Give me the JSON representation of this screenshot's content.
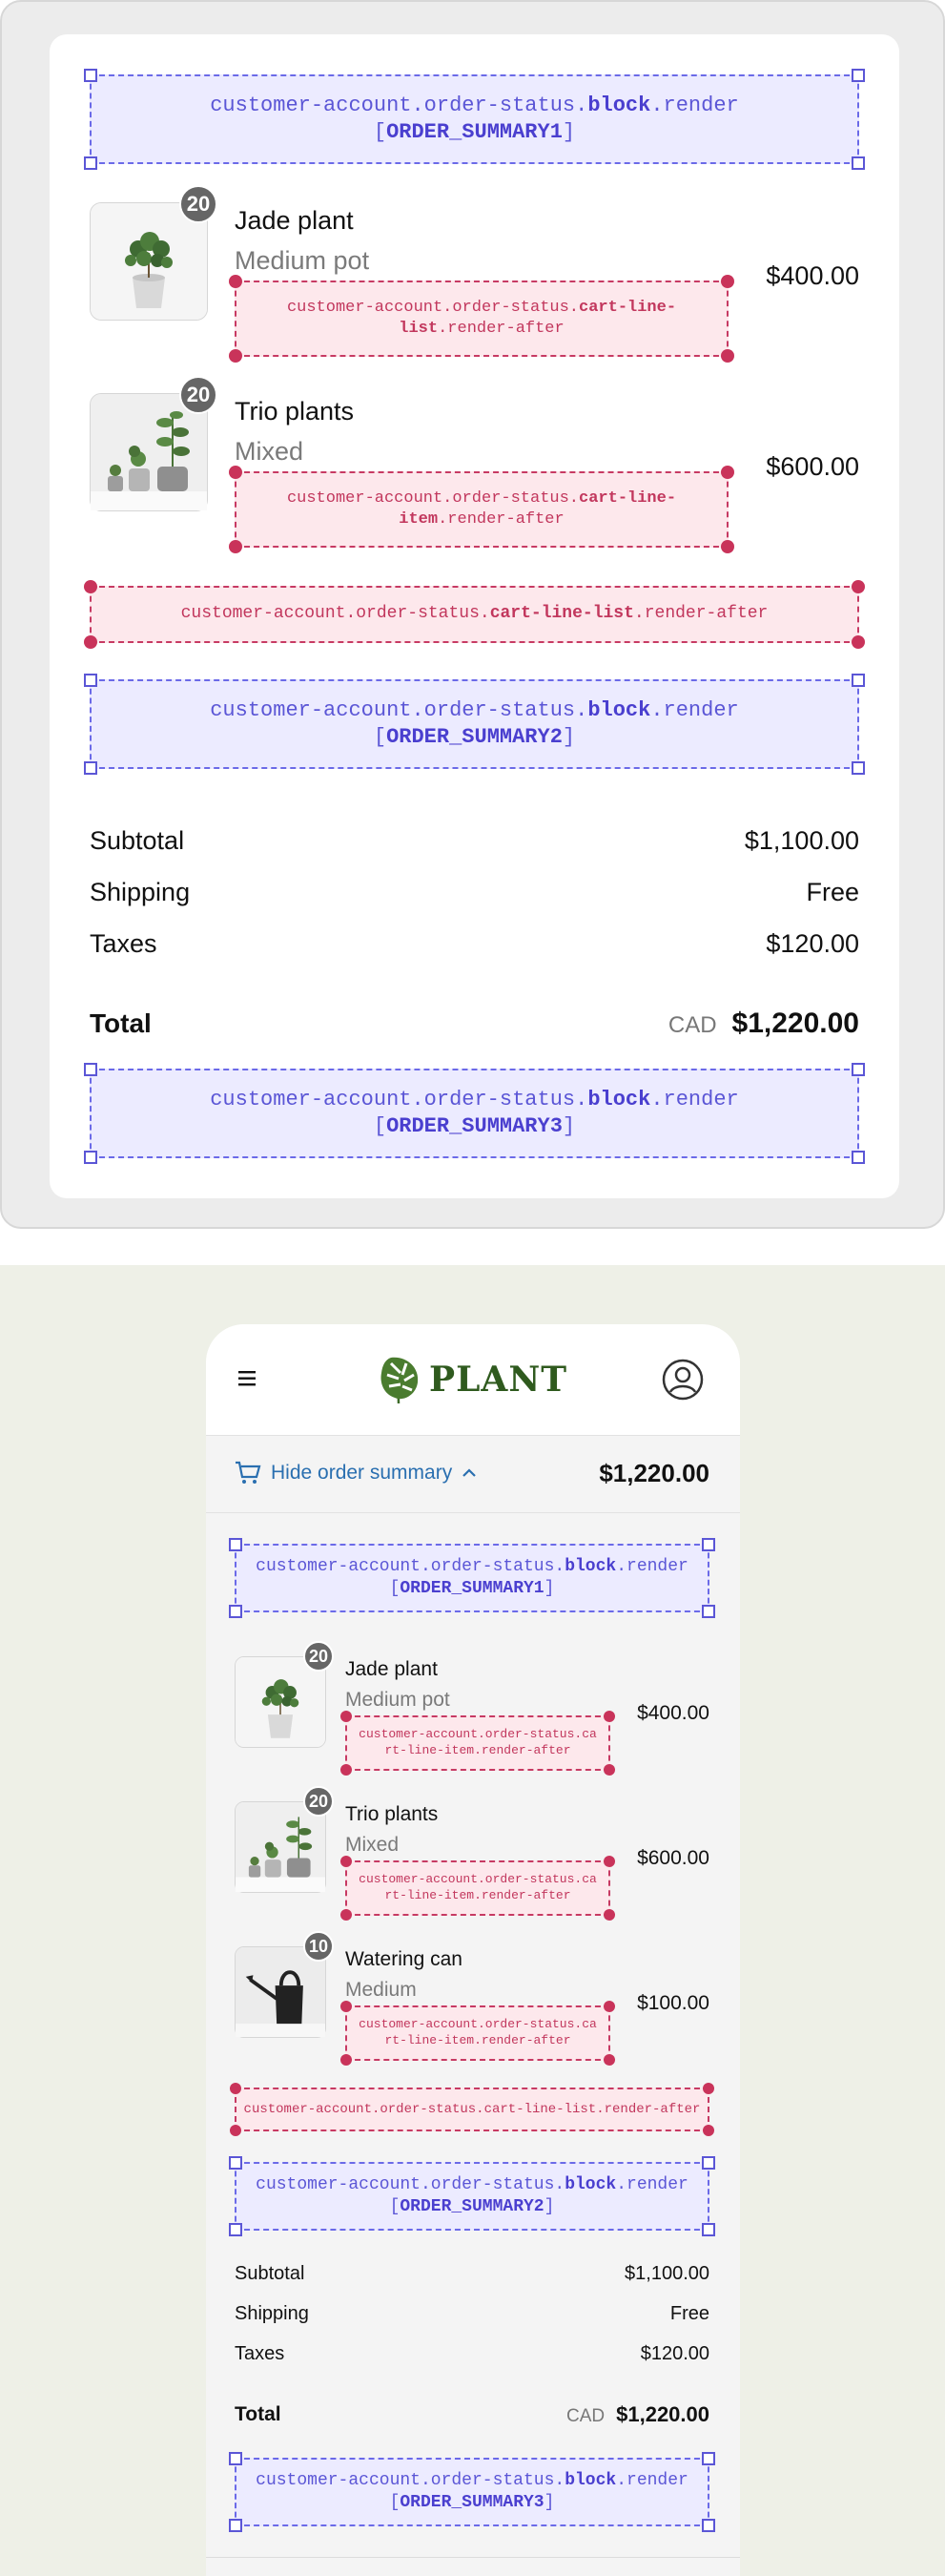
{
  "desktop": {
    "block1": {
      "prefix": "customer-account.order-status.",
      "bold": "block",
      "suffix": ".render",
      "target": "ORDER_SUMMARY1"
    },
    "items": [
      {
        "name": "Jade plant",
        "variant": "Medium pot",
        "price": "$400.00",
        "qty": "20",
        "ext": {
          "prefix": "customer-account.order-status.",
          "bold": "cart-line-list",
          "suffix": ".render-after"
        }
      },
      {
        "name": "Trio plants",
        "variant": "Mixed",
        "price": "$600.00",
        "qty": "20",
        "ext": {
          "prefix": "customer-account.order-status.",
          "bold": "cart-line-item",
          "suffix": ".render-after"
        }
      }
    ],
    "list_ext": {
      "prefix": "customer-account.order-status.",
      "bold": "cart-line-list",
      "suffix": ".render-after"
    },
    "block2": {
      "prefix": "customer-account.order-status.",
      "bold": "block",
      "suffix": ".render",
      "target": "ORDER_SUMMARY2"
    },
    "subtotal_label": "Subtotal",
    "subtotal_value": "$1,100.00",
    "shipping_label": "Shipping",
    "shipping_value": "Free",
    "taxes_label": "Taxes",
    "taxes_value": "$120.00",
    "total_label": "Total",
    "currency": "CAD",
    "total_value": "$1,220.00",
    "block3": {
      "prefix": "customer-account.order-status.",
      "bold": "block",
      "suffix": ".render",
      "target": "ORDER_SUMMARY3"
    }
  },
  "mobile": {
    "brand": "PLANT",
    "toggle_label": "Hide order summary",
    "summary_total": "$1,220.00",
    "block1": {
      "prefix": "customer-account.order-status.",
      "bold": "block",
      "suffix": ".render",
      "target": "ORDER_SUMMARY1"
    },
    "items": [
      {
        "name": "Jade plant",
        "variant": "Medium pot",
        "price": "$400.00",
        "qty": "20",
        "ext": "customer-account.order-status.cart-line-item.render-after"
      },
      {
        "name": "Trio plants",
        "variant": "Mixed",
        "price": "$600.00",
        "qty": "20",
        "ext": "customer-account.order-status.cart-line-item.render-after"
      },
      {
        "name": "Watering can",
        "variant": "Medium",
        "price": "$100.00",
        "qty": "10",
        "ext": "customer-account.order-status.cart-line-item.render-after"
      }
    ],
    "list_ext": "customer-account.order-status.cart-line-list.render-after",
    "block2": {
      "prefix": "customer-account.order-status.",
      "bold": "block",
      "suffix": ".render",
      "target": "ORDER_SUMMARY2"
    },
    "subtotal_label": "Subtotal",
    "subtotal_value": "$1,100.00",
    "shipping_label": "Shipping",
    "shipping_value": "Free",
    "taxes_label": "Taxes",
    "taxes_value": "$120.00",
    "total_label": "Total",
    "currency": "CAD",
    "total_value": "$1,220.00",
    "block3": {
      "prefix": "customer-account.order-status.",
      "bold": "block",
      "suffix": ".render",
      "target": "ORDER_SUMMARY3"
    }
  },
  "icons": {
    "menu": "hamburger-icon",
    "account": "account-icon",
    "cart": "cart-icon",
    "chevron": "chevron-up-icon",
    "logo": "monstera-leaf-icon"
  },
  "colors": {
    "block_accent": "#5b56d6",
    "ext_accent": "#c73a63",
    "link": "#2a6fb0",
    "brand": "#3d6b28"
  }
}
